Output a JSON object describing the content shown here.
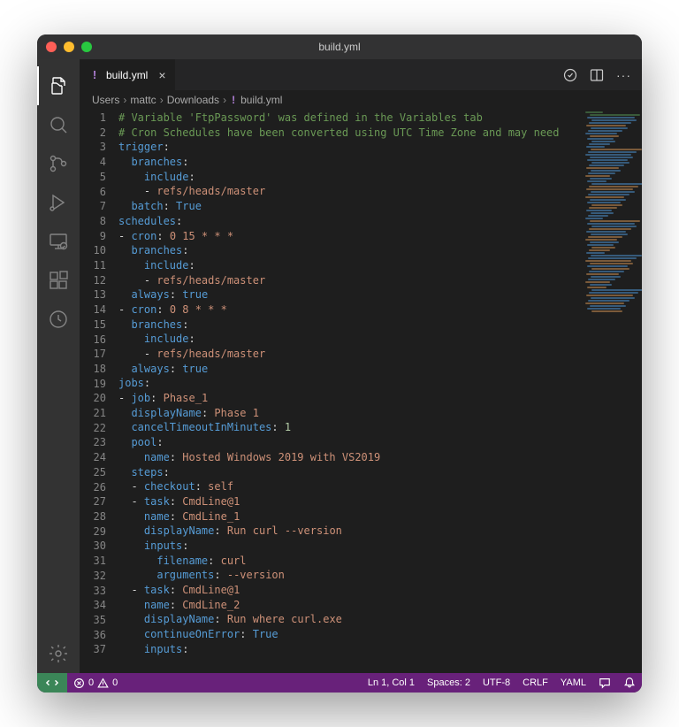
{
  "window": {
    "title": "build.yml"
  },
  "tab": {
    "label": "build.yml"
  },
  "breadcrumbs": {
    "seg1": "Users",
    "seg2": "mattc",
    "seg3": "Downloads",
    "seg4": "build.yml"
  },
  "code": {
    "lines": [
      {
        "n": "1",
        "t": "comment",
        "text": "# Variable 'FtpPassword' was defined in the Variables tab"
      },
      {
        "n": "2",
        "t": "comment",
        "text": "# Cron Schedules have been converted using UTC Time Zone and may need"
      },
      {
        "n": "3",
        "tokens": [
          {
            "c": "key",
            "v": "trigger"
          },
          {
            "c": "punc",
            "v": ":"
          }
        ]
      },
      {
        "n": "4",
        "indent": 2,
        "tokens": [
          {
            "c": "key",
            "v": "branches"
          },
          {
            "c": "punc",
            "v": ":"
          }
        ]
      },
      {
        "n": "5",
        "indent": 4,
        "tokens": [
          {
            "c": "key",
            "v": "include"
          },
          {
            "c": "punc",
            "v": ":"
          }
        ]
      },
      {
        "n": "6",
        "indent": 4,
        "tokens": [
          {
            "c": "dash",
            "v": "- "
          },
          {
            "c": "str",
            "v": "refs/heads/master"
          }
        ]
      },
      {
        "n": "7",
        "indent": 2,
        "tokens": [
          {
            "c": "key",
            "v": "batch"
          },
          {
            "c": "punc",
            "v": ": "
          },
          {
            "c": "bool",
            "v": "True"
          }
        ]
      },
      {
        "n": "8",
        "tokens": [
          {
            "c": "key",
            "v": "schedules"
          },
          {
            "c": "punc",
            "v": ":"
          }
        ]
      },
      {
        "n": "9",
        "tokens": [
          {
            "c": "dash",
            "v": "- "
          },
          {
            "c": "key",
            "v": "cron"
          },
          {
            "c": "punc",
            "v": ": "
          },
          {
            "c": "str",
            "v": "0 15 * * *"
          }
        ]
      },
      {
        "n": "10",
        "indent": 2,
        "tokens": [
          {
            "c": "key",
            "v": "branches"
          },
          {
            "c": "punc",
            "v": ":"
          }
        ]
      },
      {
        "n": "11",
        "indent": 4,
        "tokens": [
          {
            "c": "key",
            "v": "include"
          },
          {
            "c": "punc",
            "v": ":"
          }
        ]
      },
      {
        "n": "12",
        "indent": 4,
        "tokens": [
          {
            "c": "dash",
            "v": "- "
          },
          {
            "c": "str",
            "v": "refs/heads/master"
          }
        ]
      },
      {
        "n": "13",
        "indent": 2,
        "tokens": [
          {
            "c": "key",
            "v": "always"
          },
          {
            "c": "punc",
            "v": ": "
          },
          {
            "c": "bool",
            "v": "true"
          }
        ]
      },
      {
        "n": "14",
        "tokens": [
          {
            "c": "dash",
            "v": "- "
          },
          {
            "c": "key",
            "v": "cron"
          },
          {
            "c": "punc",
            "v": ": "
          },
          {
            "c": "str",
            "v": "0 8 * * *"
          }
        ]
      },
      {
        "n": "15",
        "indent": 2,
        "tokens": [
          {
            "c": "key",
            "v": "branches"
          },
          {
            "c": "punc",
            "v": ":"
          }
        ]
      },
      {
        "n": "16",
        "indent": 4,
        "tokens": [
          {
            "c": "key",
            "v": "include"
          },
          {
            "c": "punc",
            "v": ":"
          }
        ]
      },
      {
        "n": "17",
        "indent": 4,
        "tokens": [
          {
            "c": "dash",
            "v": "- "
          },
          {
            "c": "str",
            "v": "refs/heads/master"
          }
        ]
      },
      {
        "n": "18",
        "indent": 2,
        "tokens": [
          {
            "c": "key",
            "v": "always"
          },
          {
            "c": "punc",
            "v": ": "
          },
          {
            "c": "bool",
            "v": "true"
          }
        ]
      },
      {
        "n": "19",
        "tokens": [
          {
            "c": "key",
            "v": "jobs"
          },
          {
            "c": "punc",
            "v": ":"
          }
        ]
      },
      {
        "n": "20",
        "tokens": [
          {
            "c": "dash",
            "v": "- "
          },
          {
            "c": "key",
            "v": "job"
          },
          {
            "c": "punc",
            "v": ": "
          },
          {
            "c": "str",
            "v": "Phase_1"
          }
        ]
      },
      {
        "n": "21",
        "indent": 2,
        "tokens": [
          {
            "c": "key",
            "v": "displayName"
          },
          {
            "c": "punc",
            "v": ": "
          },
          {
            "c": "str",
            "v": "Phase 1"
          }
        ]
      },
      {
        "n": "22",
        "indent": 2,
        "tokens": [
          {
            "c": "key",
            "v": "cancelTimeoutInMinutes"
          },
          {
            "c": "punc",
            "v": ": "
          },
          {
            "c": "num",
            "v": "1"
          }
        ]
      },
      {
        "n": "23",
        "indent": 2,
        "tokens": [
          {
            "c": "key",
            "v": "pool"
          },
          {
            "c": "punc",
            "v": ":"
          }
        ]
      },
      {
        "n": "24",
        "indent": 4,
        "tokens": [
          {
            "c": "key",
            "v": "name"
          },
          {
            "c": "punc",
            "v": ": "
          },
          {
            "c": "str",
            "v": "Hosted Windows 2019 with VS2019"
          }
        ]
      },
      {
        "n": "25",
        "indent": 2,
        "tokens": [
          {
            "c": "key",
            "v": "steps"
          },
          {
            "c": "punc",
            "v": ":"
          }
        ]
      },
      {
        "n": "26",
        "indent": 2,
        "tokens": [
          {
            "c": "dash",
            "v": "- "
          },
          {
            "c": "key",
            "v": "checkout"
          },
          {
            "c": "punc",
            "v": ": "
          },
          {
            "c": "str",
            "v": "self"
          }
        ]
      },
      {
        "n": "27",
        "indent": 2,
        "tokens": [
          {
            "c": "dash",
            "v": "- "
          },
          {
            "c": "key",
            "v": "task"
          },
          {
            "c": "punc",
            "v": ": "
          },
          {
            "c": "str",
            "v": "CmdLine@1"
          }
        ]
      },
      {
        "n": "28",
        "indent": 4,
        "tokens": [
          {
            "c": "key",
            "v": "name"
          },
          {
            "c": "punc",
            "v": ": "
          },
          {
            "c": "str",
            "v": "CmdLine_1"
          }
        ]
      },
      {
        "n": "29",
        "indent": 4,
        "tokens": [
          {
            "c": "key",
            "v": "displayName"
          },
          {
            "c": "punc",
            "v": ": "
          },
          {
            "c": "str",
            "v": "Run curl --version"
          }
        ]
      },
      {
        "n": "30",
        "indent": 4,
        "tokens": [
          {
            "c": "key",
            "v": "inputs"
          },
          {
            "c": "punc",
            "v": ":"
          }
        ]
      },
      {
        "n": "31",
        "indent": 6,
        "tokens": [
          {
            "c": "key",
            "v": "filename"
          },
          {
            "c": "punc",
            "v": ": "
          },
          {
            "c": "str",
            "v": "curl"
          }
        ]
      },
      {
        "n": "32",
        "indent": 6,
        "tokens": [
          {
            "c": "key",
            "v": "arguments"
          },
          {
            "c": "punc",
            "v": ": "
          },
          {
            "c": "str",
            "v": "--version"
          }
        ]
      },
      {
        "n": "33",
        "indent": 2,
        "tokens": [
          {
            "c": "dash",
            "v": "- "
          },
          {
            "c": "key",
            "v": "task"
          },
          {
            "c": "punc",
            "v": ": "
          },
          {
            "c": "str",
            "v": "CmdLine@1"
          }
        ]
      },
      {
        "n": "34",
        "indent": 4,
        "tokens": [
          {
            "c": "key",
            "v": "name"
          },
          {
            "c": "punc",
            "v": ": "
          },
          {
            "c": "str",
            "v": "CmdLine_2"
          }
        ]
      },
      {
        "n": "35",
        "indent": 4,
        "tokens": [
          {
            "c": "key",
            "v": "displayName"
          },
          {
            "c": "punc",
            "v": ": "
          },
          {
            "c": "str",
            "v": "Run where curl.exe"
          }
        ]
      },
      {
        "n": "36",
        "indent": 4,
        "tokens": [
          {
            "c": "key",
            "v": "continueOnError"
          },
          {
            "c": "punc",
            "v": ": "
          },
          {
            "c": "bool",
            "v": "True"
          }
        ]
      },
      {
        "n": "37",
        "indent": 4,
        "tokens": [
          {
            "c": "key",
            "v": "inputs"
          },
          {
            "c": "punc",
            "v": ":"
          }
        ]
      }
    ]
  },
  "statusbar": {
    "errors": "0",
    "warnings": "0",
    "cursor": "Ln 1, Col 1",
    "spaces": "Spaces: 2",
    "encoding": "UTF-8",
    "eol": "CRLF",
    "lang": "YAML"
  }
}
